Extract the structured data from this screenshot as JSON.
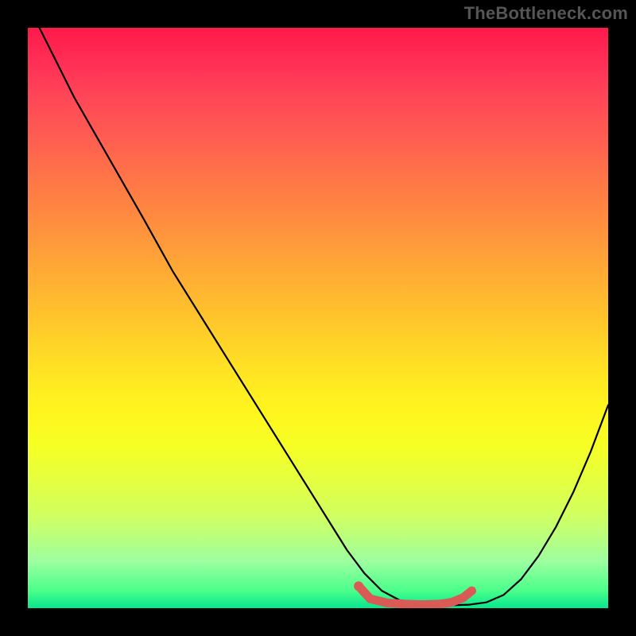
{
  "watermark": "TheBottleneck.com",
  "chart_data": {
    "type": "line",
    "title": "",
    "xlabel": "",
    "ylabel": "",
    "xlim": [
      0,
      100
    ],
    "ylim": [
      0,
      100
    ],
    "grid": false,
    "legend": false,
    "background": "rainbow-gradient",
    "series": [
      {
        "name": "bottleneck-curve",
        "color": "#000000",
        "x": [
          2,
          5,
          8,
          12,
          16,
          20,
          25,
          30,
          35,
          40,
          45,
          50,
          55,
          58,
          61,
          64,
          67,
          70,
          73,
          76,
          79,
          82,
          85,
          88,
          91,
          94,
          97,
          100
        ],
        "y": [
          100,
          94,
          88,
          81,
          74,
          67,
          58,
          50,
          42,
          34,
          26,
          18,
          10,
          6,
          3,
          1.4,
          0.9,
          0.6,
          0.5,
          0.6,
          1.0,
          2.3,
          5.0,
          9.0,
          14,
          20,
          27,
          35
        ]
      },
      {
        "name": "sweet-spot-marker",
        "color": "#da5a55",
        "x": [
          57,
          59,
          62,
          65,
          68,
          71,
          73,
          75,
          76.5
        ],
        "y": [
          3.8,
          1.6,
          0.9,
          0.7,
          0.6,
          0.7,
          1.0,
          1.8,
          3.0
        ]
      }
    ],
    "annotations": [
      {
        "type": "dot",
        "x": 57,
        "y": 3.8,
        "color": "#da5a55",
        "radius": 6
      }
    ]
  }
}
